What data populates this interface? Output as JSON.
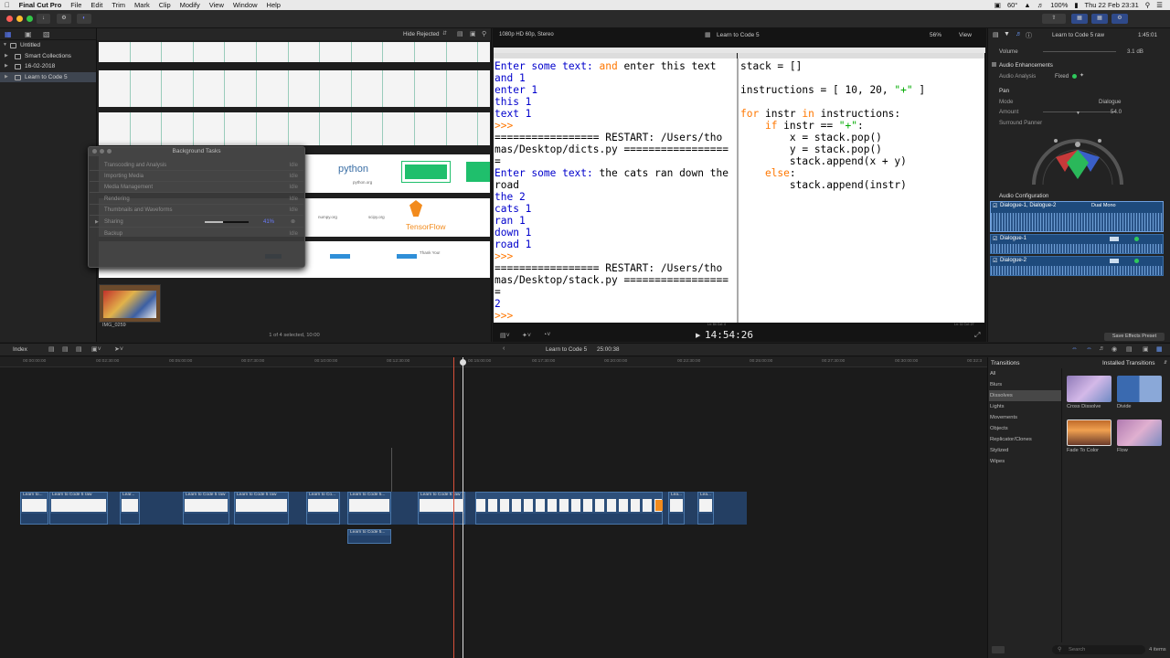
{
  "menubar": {
    "app_name": "Final Cut Pro",
    "items": [
      "File",
      "Edit",
      "Trim",
      "Mark",
      "Clip",
      "Modify",
      "View",
      "Window",
      "Help"
    ],
    "temp": "60°",
    "battery": "100%",
    "clock": "Thu 22 Feb  23:31"
  },
  "library": {
    "items": [
      {
        "label": "Untitled"
      },
      {
        "label": "Smart Collections"
      },
      {
        "label": "16-02-2018"
      },
      {
        "label": "Learn to Code 5"
      }
    ]
  },
  "browser": {
    "filter_label": "Hide Rejected",
    "python_label": "python",
    "python_site": "python.org",
    "numpy_label": "numpy.org",
    "scipy_label": "scipy.org",
    "tensorflow_label": "TensorFlow",
    "thankyou_label": "Thank You!",
    "thumb_label": "IMG_0259",
    "status": "1 of 4 selected, 10:00"
  },
  "background_tasks": {
    "title": "Background Tasks",
    "tasks": [
      {
        "name": "Transcoding and Analysis",
        "status": "Idle"
      },
      {
        "name": "Importing Media",
        "status": "Idle"
      },
      {
        "name": "Media Management",
        "status": "Idle"
      },
      {
        "name": "Rendering",
        "status": "Idle"
      },
      {
        "name": "Thumbnails and Waveforms",
        "status": "Idle"
      },
      {
        "name": "Sharing",
        "status": "",
        "percent": "41%"
      },
      {
        "name": "Backup",
        "status": "Idle"
      }
    ],
    "sharing_progress": 0.41
  },
  "viewer": {
    "format": "1080p HD 60p, Stereo",
    "project": "Learn to Code 5",
    "zoom": "56%",
    "view_label": "View",
    "timecode": "14:54:26",
    "left_status": "Ln: 84  Col: 4",
    "right_status": "Ln: 11  Col: 27"
  },
  "code_left": {
    "lines": [
      {
        "parts": [
          {
            "t": "Enter some text: ",
            "c": "blue"
          },
          {
            "t": "and",
            "c": "orange"
          },
          {
            "t": " enter this text",
            "c": "blk"
          }
        ]
      },
      {
        "parts": [
          {
            "t": "and 1",
            "c": "blue"
          }
        ]
      },
      {
        "parts": [
          {
            "t": "enter 1",
            "c": "blue"
          }
        ]
      },
      {
        "parts": [
          {
            "t": "this 1",
            "c": "blue"
          }
        ]
      },
      {
        "parts": [
          {
            "t": "text 1",
            "c": "blue"
          }
        ]
      },
      {
        "parts": [
          {
            "t": ">>>",
            "c": "orange"
          }
        ]
      },
      {
        "parts": [
          {
            "t": "================= RESTART: /Users/tho",
            "c": "blk"
          }
        ]
      },
      {
        "parts": [
          {
            "t": "mas/Desktop/dicts.py =================",
            "c": "blk"
          }
        ]
      },
      {
        "parts": [
          {
            "t": "=",
            "c": "blk"
          }
        ]
      },
      {
        "parts": [
          {
            "t": "Enter some text: ",
            "c": "blue"
          },
          {
            "t": "the cats ran down the",
            "c": "blk"
          }
        ]
      },
      {
        "parts": [
          {
            "t": "road",
            "c": "blk"
          }
        ]
      },
      {
        "parts": [
          {
            "t": "the 2",
            "c": "blue"
          }
        ]
      },
      {
        "parts": [
          {
            "t": "cats 1",
            "c": "blue"
          }
        ]
      },
      {
        "parts": [
          {
            "t": "ran 1",
            "c": "blue"
          }
        ]
      },
      {
        "parts": [
          {
            "t": "down 1",
            "c": "blue"
          }
        ]
      },
      {
        "parts": [
          {
            "t": "road 1",
            "c": "blue"
          }
        ]
      },
      {
        "parts": [
          {
            "t": ">>>",
            "c": "orange"
          }
        ]
      },
      {
        "parts": [
          {
            "t": "================= RESTART: /Users/tho",
            "c": "blk"
          }
        ]
      },
      {
        "parts": [
          {
            "t": "mas/Desktop/stack.py =================",
            "c": "blk"
          }
        ]
      },
      {
        "parts": [
          {
            "t": "=",
            "c": "blk"
          }
        ]
      },
      {
        "parts": [
          {
            "t": "2",
            "c": "blue"
          }
        ]
      },
      {
        "parts": [
          {
            "t": ">>>",
            "c": "orange"
          }
        ]
      }
    ]
  },
  "code_right": {
    "lines": [
      {
        "parts": [
          {
            "t": "stack = []",
            "c": "blk"
          }
        ]
      },
      {
        "parts": [
          {
            "t": "",
            "c": "blk"
          }
        ]
      },
      {
        "parts": [
          {
            "t": "instructions = [ 10, 20, ",
            "c": "blk"
          },
          {
            "t": "\"+\"",
            "c": "green"
          },
          {
            "t": " ]",
            "c": "blk"
          }
        ]
      },
      {
        "parts": [
          {
            "t": "",
            "c": "blk"
          }
        ]
      },
      {
        "parts": [
          {
            "t": "for",
            "c": "orange"
          },
          {
            "t": " instr ",
            "c": "blk"
          },
          {
            "t": "in",
            "c": "orange"
          },
          {
            "t": " instructions:",
            "c": "blk"
          }
        ]
      },
      {
        "parts": [
          {
            "t": "    ",
            "c": "blk"
          },
          {
            "t": "if",
            "c": "orange"
          },
          {
            "t": " instr == ",
            "c": "blk"
          },
          {
            "t": "\"+\"",
            "c": "green"
          },
          {
            "t": ":",
            "c": "blk"
          }
        ]
      },
      {
        "parts": [
          {
            "t": "        x = stack.pop()",
            "c": "blk"
          }
        ]
      },
      {
        "parts": [
          {
            "t": "        y = stack.pop()",
            "c": "blk"
          }
        ]
      },
      {
        "parts": [
          {
            "t": "        stack.append(x + y)",
            "c": "blk"
          }
        ]
      },
      {
        "parts": [
          {
            "t": "    ",
            "c": "blk"
          },
          {
            "t": "else",
            "c": "orange"
          },
          {
            "t": ":",
            "c": "blk"
          }
        ]
      },
      {
        "parts": [
          {
            "t": "        stack.append(instr)",
            "c": "blk"
          }
        ]
      }
    ]
  },
  "inspector": {
    "clip_name": "Learn to Code 5 raw",
    "duration": "1:45:01",
    "volume_label": "Volume",
    "volume_value": "3.1 dB",
    "enhancements_label": "Audio Enhancements",
    "analysis_label": "Audio Analysis",
    "analysis_value": "Fixed",
    "pan_label": "Pan",
    "mode_label": "Mode",
    "mode_value": "Dialogue",
    "amount_label": "Amount",
    "amount_value": "54.0",
    "surround_label": "Surround Panner",
    "config_label": "Audio Configuration",
    "channels": [
      {
        "name": "Dialogue-1, Dialogue-2",
        "mode": "Dual Mono"
      },
      {
        "name": "Dialogue-1",
        "mode": ""
      },
      {
        "name": "Dialogue-2",
        "mode": ""
      }
    ],
    "save_preset": "Save Effects Preset"
  },
  "timeline": {
    "index_label": "Index",
    "project": "Learn to Code 5",
    "duration": "25:00:38",
    "ticks": [
      "00:00:00:00",
      "00:02:30:00",
      "00:05:00:00",
      "00:07:30:00",
      "00:10:00:00",
      "00:12:30:00",
      "00:15:00:00",
      "00:17:30:00",
      "00:20:00:00",
      "00:22:30:00",
      "00:25:00:00",
      "00:27:30:00",
      "00:30:00:00",
      "00:32:3"
    ],
    "clips": [
      {
        "label": "Learn to..."
      },
      {
        "label": "Learn to Code 5 raw"
      },
      {
        "label": "Lear..."
      },
      {
        "label": "Learn to Code 5 raw"
      },
      {
        "label": "Learn to Code 5 raw"
      },
      {
        "label": "Learn to Co..."
      },
      {
        "label": "Learn to Code 5..."
      },
      {
        "label": "Learn to Code 5 raw"
      },
      {
        "label": "Lea..."
      },
      {
        "label": "Lea..."
      }
    ],
    "connected_clip": "Learn to Code 5..."
  },
  "transitions": {
    "title": "Transitions",
    "installed": "Installed Transitions",
    "categories": [
      "All",
      "Blurs",
      "Dissolves",
      "Lights",
      "Movements",
      "Objects",
      "Replicator/Clones",
      "Stylized",
      "Wipes"
    ],
    "selected_category": "Dissolves",
    "items": [
      {
        "name": "Cross Dissolve"
      },
      {
        "name": "Divide"
      },
      {
        "name": "Fade To Color"
      },
      {
        "name": "Flow"
      }
    ],
    "search_placeholder": "Search",
    "count": "4 items"
  }
}
